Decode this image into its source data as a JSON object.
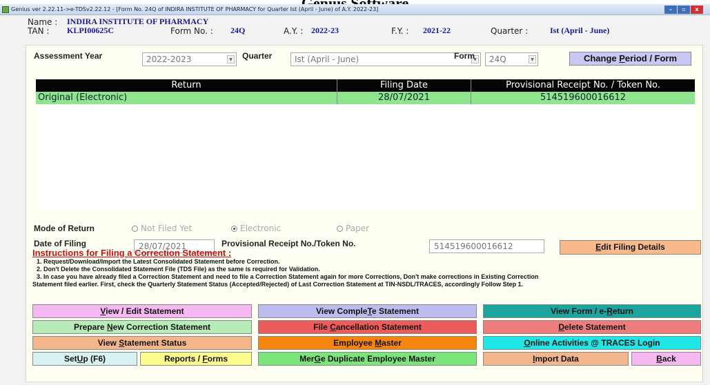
{
  "caption": "Genius Software",
  "window": {
    "title": "Genius ver 2.22.11->e-TDSv2.22.12 - [Form No. 24Q of INDIRA INSTITUTE OF PHARMACY for Quarter Ist (April - June) of A.Y. 2022-23]",
    "min": "–",
    "max": "▫",
    "close": "x"
  },
  "header": {
    "name_label": "Name :",
    "name_value": "INDIRA INSTITUTE OF PHARMACY",
    "tan_label": "TAN :",
    "tan_value": "KLPI00625C",
    "form_label": "Form No. :",
    "form_value": "24Q",
    "ay_label": "A.Y. :",
    "ay_value": "2022-23",
    "fy_label": "F.Y. :",
    "fy_value": "2021-22",
    "quarter_label": "Quarter :",
    "quarter_value": "Ist (April - June)"
  },
  "period": {
    "ay_label": "Assessment Year",
    "ay_value": "2022-2023",
    "quarter_label": "Quarter",
    "quarter_value": "Ist (April - June)",
    "form_label": "Form",
    "form_value": "24Q",
    "change_btn_pre": "Change ",
    "change_btn_u": "P",
    "change_btn_post": "eriod / Form"
  },
  "returns_table": {
    "columns": [
      "Return",
      "Filing Date",
      "Provisional Receipt No. / Token No."
    ],
    "rows": [
      [
        "Original (Electronic)",
        "28/07/2021",
        "514519600016612"
      ]
    ]
  },
  "mode": {
    "label": "Mode of Return",
    "options": [
      "Not Filed Yet",
      "Electronic",
      "Paper"
    ],
    "selected": "Electronic"
  },
  "filing": {
    "date_label": "Date of Filing",
    "date_value": "28/07/2021",
    "token_label": "Provisional Receipt No./Token No.",
    "token_value": "514519600016612",
    "edit_btn_pre": "",
    "edit_btn_u": "E",
    "edit_btn_post": "dit Filing Details"
  },
  "instructions": {
    "title": "Instructions for Filing a Correction Statement :",
    "lines": [
      "1. Request/Download/Import the Latest Consolidated Statement before Correction.",
      "2. Don't Delete the Consolidated Statement File (TDS File) as the same is required for Validation.",
      "3. In case you have already filed a Correction Statement and need to file a Correction Statement again for more Corrections, Don't make corrections in Existing Correction",
      "Statement filed earlier. First, check the Quarterly Statement Status (Accepted/Rejected) of Last Correction Statement at TIN-NSDL/TRACES, accordingly Follow Step 1."
    ]
  },
  "buttons": {
    "view_edit": {
      "pre": "",
      "u": "V",
      "post": "iew / Edit Statement"
    },
    "view_complete": {
      "pre": "View Comple",
      "u": "T",
      "post": "e Statement"
    },
    "view_form": {
      "pre": "View Form / e-",
      "u": "R",
      "post": "eturn"
    },
    "prepare_new": {
      "pre": "Prepare ",
      "u": "N",
      "post": "ew Correction Statement"
    },
    "file_cancel": {
      "pre": "File ",
      "u": "C",
      "post": "ancellation Statement"
    },
    "delete": {
      "pre": "",
      "u": "D",
      "post": "elete Statement"
    },
    "view_status": {
      "pre": "View ",
      "u": "S",
      "post": "tatement Status"
    },
    "employee_master": {
      "pre": "Employee ",
      "u": "M",
      "post": "aster"
    },
    "online": {
      "pre": "",
      "u": "O",
      "post": "nline Activities @ TRACES Login"
    },
    "setup": {
      "pre": "Set",
      "u": "U",
      "post": "p (F6)"
    },
    "reports": {
      "pre": "Reports / ",
      "u": "F",
      "post": "orms"
    },
    "merge": {
      "pre": "Mer",
      "u": "G",
      "post": "e Duplicate Employee Master"
    },
    "import": {
      "pre": "",
      "u": "I",
      "post": "mport Data"
    },
    "back": {
      "pre": "",
      "u": "B",
      "post": "ack"
    }
  },
  "colors": {
    "grid_header": "#050505",
    "grid_row": "#8ee58e",
    "instr_title": "#d01010",
    "value_blue": "#1a1a99"
  }
}
